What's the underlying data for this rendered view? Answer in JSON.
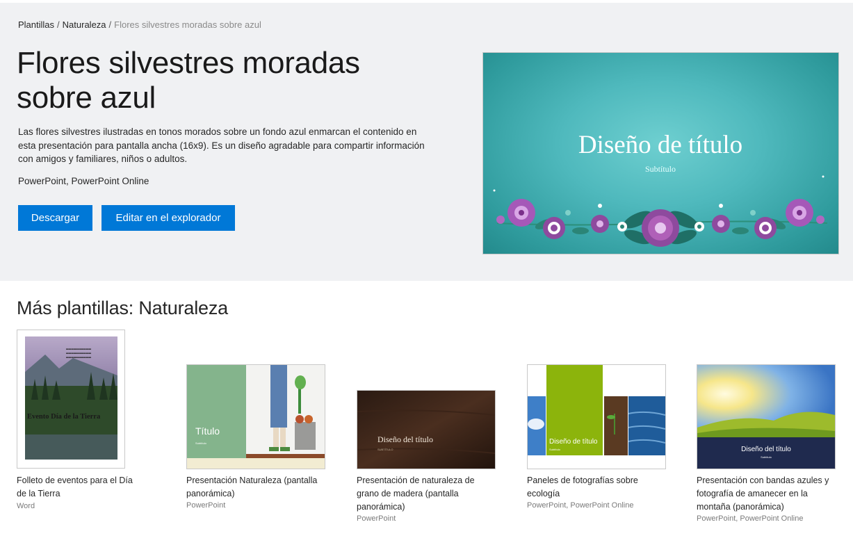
{
  "breadcrumb": {
    "items": [
      "Plantillas",
      "Naturaleza"
    ],
    "separator": "/",
    "current": "Flores silvestres moradas sobre azul"
  },
  "hero": {
    "title": "Flores silvestres moradas sobre azul",
    "description": "Las flores silvestres ilustradas en tonos morados sobre un fondo azul enmarcan el contenido en esta presentación para pantalla ancha (16x9). Es un diseño agradable para compartir información con amigos y familiares, niños o adultos.",
    "apps": "PowerPoint, PowerPoint Online",
    "download_label": "Descargar",
    "edit_label": "Editar en el explorador",
    "preview": {
      "title": "Diseño de título",
      "subtitle": "Subtítulo"
    }
  },
  "more": {
    "heading": "Más plantillas: Naturaleza",
    "cards": [
      {
        "name": "Folleto de eventos para el Día de la Tierra",
        "app": "Word",
        "thumb_text": "Evento Día de la Tierra"
      },
      {
        "name": "Presentación Naturaleza (pantalla panorámica)",
        "app": "PowerPoint",
        "thumb_text": "Título",
        "thumb_sub": "Subtítulo"
      },
      {
        "name": "Presentación de naturaleza de grano de madera (pantalla panorámica)",
        "app": "PowerPoint",
        "thumb_text": "Diseño del título",
        "thumb_sub": "SUBTÍTULO"
      },
      {
        "name": "Paneles de fotografías sobre ecología",
        "app": "PowerPoint, PowerPoint Online",
        "thumb_text": "Diseño de título",
        "thumb_sub": "Subtítulo"
      },
      {
        "name": "Presentación con bandas azules y fotografía de amanecer en la montaña (panorámica)",
        "app": "PowerPoint, PowerPoint Online",
        "thumb_text": "Diseño del título",
        "thumb_sub": "Subtítulo"
      }
    ]
  },
  "colors": {
    "accent": "#0078d7",
    "hero_bg": "#f0f1f3",
    "preview_teal": "#4fb9bd",
    "flower_purple": "#8e44ad"
  }
}
